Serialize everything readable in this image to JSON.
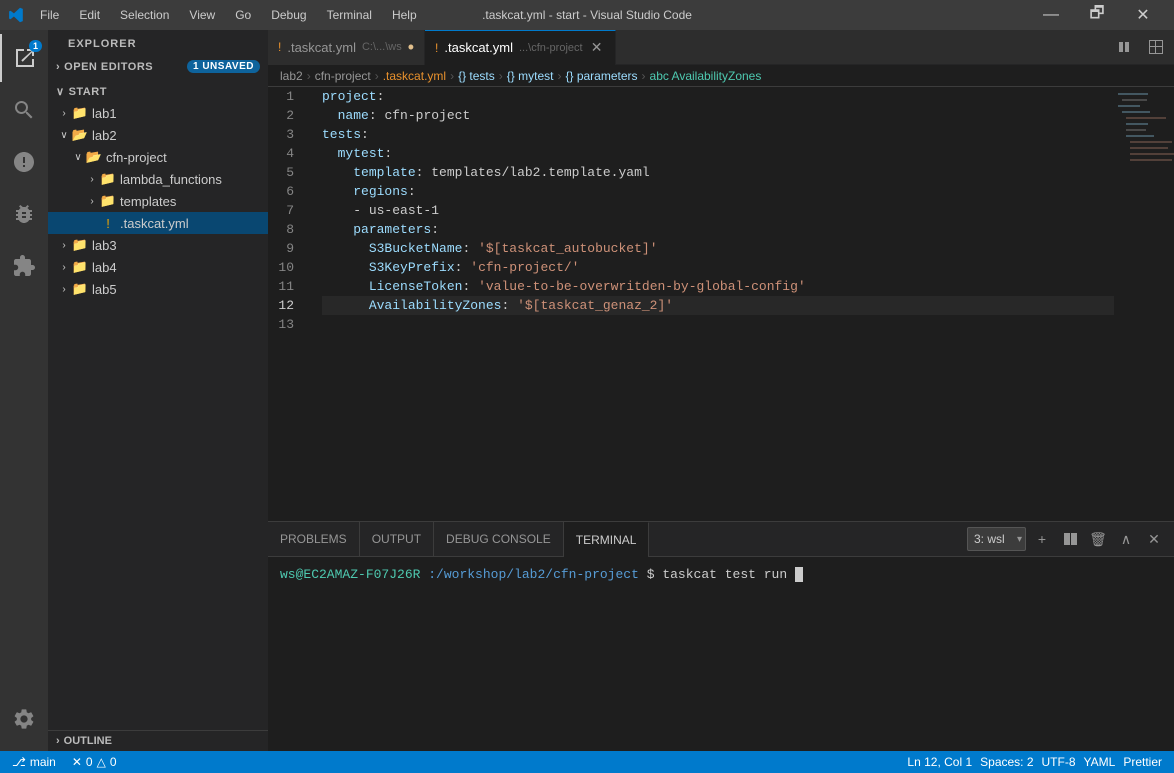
{
  "titlebar": {
    "title": ".taskcat.yml - start - Visual Studio Code",
    "menu_items": [
      "File",
      "Edit",
      "Selection",
      "View",
      "Go",
      "Debug",
      "Terminal",
      "Help"
    ],
    "min_label": "—",
    "max_label": "🗗",
    "close_label": "✕"
  },
  "tabs": [
    {
      "id": "tab1",
      "icon": "!",
      "name": ".taskcat.yml",
      "path": "C:\\...\\ws",
      "modified": true,
      "active": false,
      "closeable": false
    },
    {
      "id": "tab2",
      "icon": "!",
      "name": ".taskcat.yml",
      "path": "...\\cfn-project",
      "modified": false,
      "active": true,
      "closeable": true
    }
  ],
  "breadcrumb": {
    "items": [
      "lab2",
      "cfn-project",
      ".taskcat.yml",
      "{} tests",
      "{} mytest",
      "{} parameters",
      "abc AvailabilityZones"
    ]
  },
  "code_lines": [
    {
      "num": 1,
      "tokens": [
        {
          "t": "key",
          "v": "project"
        },
        {
          "t": "colon",
          "v": ":"
        }
      ]
    },
    {
      "num": 2,
      "tokens": [
        {
          "t": "indent",
          "v": "  "
        },
        {
          "t": "key",
          "v": "name"
        },
        {
          "t": "colon",
          "v": ":"
        },
        {
          "t": "plain",
          "v": " cfn-project"
        }
      ]
    },
    {
      "num": 3,
      "tokens": [
        {
          "t": "key",
          "v": "tests"
        },
        {
          "t": "colon",
          "v": ":"
        }
      ]
    },
    {
      "num": 4,
      "tokens": [
        {
          "t": "indent",
          "v": "  "
        },
        {
          "t": "key",
          "v": "mytest"
        },
        {
          "t": "colon",
          "v": ":"
        }
      ]
    },
    {
      "num": 5,
      "tokens": [
        {
          "t": "indent",
          "v": "    "
        },
        {
          "t": "key",
          "v": "template"
        },
        {
          "t": "colon",
          "v": ":"
        },
        {
          "t": "plain",
          "v": " templates/lab2.template.yaml"
        }
      ]
    },
    {
      "num": 6,
      "tokens": [
        {
          "t": "indent",
          "v": "    "
        },
        {
          "t": "key",
          "v": "regions"
        },
        {
          "t": "colon",
          "v": ":"
        }
      ]
    },
    {
      "num": 7,
      "tokens": [
        {
          "t": "indent",
          "v": "    "
        },
        {
          "t": "dash",
          "v": "- "
        },
        {
          "t": "plain",
          "v": "us-east-1"
        }
      ]
    },
    {
      "num": 8,
      "tokens": [
        {
          "t": "indent",
          "v": "    "
        },
        {
          "t": "key",
          "v": "parameters"
        },
        {
          "t": "colon",
          "v": ":"
        }
      ]
    },
    {
      "num": 9,
      "tokens": [
        {
          "t": "indent",
          "v": "      "
        },
        {
          "t": "key",
          "v": "S3BucketName"
        },
        {
          "t": "colon",
          "v": ":"
        },
        {
          "t": "plain",
          "v": " "
        },
        {
          "t": "str",
          "v": "'$[taskcat_autobucket]'"
        }
      ]
    },
    {
      "num": 10,
      "tokens": [
        {
          "t": "indent",
          "v": "      "
        },
        {
          "t": "key",
          "v": "S3KeyPrefix"
        },
        {
          "t": "colon",
          "v": ":"
        },
        {
          "t": "plain",
          "v": " "
        },
        {
          "t": "str",
          "v": "'cfn-project/'"
        }
      ]
    },
    {
      "num": 11,
      "tokens": [
        {
          "t": "indent",
          "v": "      "
        },
        {
          "t": "key",
          "v": "LicenseToken"
        },
        {
          "t": "colon",
          "v": ":"
        },
        {
          "t": "plain",
          "v": " "
        },
        {
          "t": "str",
          "v": "'value-to-be-overwritden-by-global-config'"
        }
      ]
    },
    {
      "num": 12,
      "tokens": [
        {
          "t": "indent",
          "v": "      "
        },
        {
          "t": "key",
          "v": "AvailabilityZones"
        },
        {
          "t": "colon",
          "v": ":"
        },
        {
          "t": "plain",
          "v": " "
        },
        {
          "t": "str",
          "v": "'$[taskcat_genaz_2]'"
        }
      ]
    },
    {
      "num": 13,
      "tokens": []
    }
  ],
  "sidebar": {
    "explorer_label": "EXPLORER",
    "open_editors_label": "OPEN EDITORS",
    "open_editors_badge": "1 UNSAVED",
    "start_label": "START",
    "items": [
      {
        "id": "lab1",
        "label": "lab1",
        "type": "folder",
        "expanded": false,
        "indent": 0
      },
      {
        "id": "lab2",
        "label": "lab2",
        "type": "folder",
        "expanded": true,
        "indent": 0
      },
      {
        "id": "cfn-project",
        "label": "cfn-project",
        "type": "folder",
        "expanded": true,
        "indent": 1
      },
      {
        "id": "lambda_functions",
        "label": "lambda_functions",
        "type": "folder",
        "expanded": false,
        "indent": 2
      },
      {
        "id": "templates",
        "label": "templates",
        "type": "folder",
        "expanded": false,
        "indent": 2
      },
      {
        "id": ".taskcat.yml",
        "label": ".taskcat.yml",
        "type": "file",
        "expanded": false,
        "indent": 2
      },
      {
        "id": "lab3",
        "label": "lab3",
        "type": "folder",
        "expanded": false,
        "indent": 0
      },
      {
        "id": "lab4",
        "label": "lab4",
        "type": "folder",
        "expanded": false,
        "indent": 0
      },
      {
        "id": "lab5",
        "label": "lab5",
        "type": "folder",
        "expanded": false,
        "indent": 0
      }
    ],
    "outline_label": "OUTLINE"
  },
  "terminal": {
    "tabs": [
      "PROBLEMS",
      "OUTPUT",
      "DEBUG CONSOLE",
      "TERMINAL"
    ],
    "active_tab": "TERMINAL",
    "shell_options": [
      "3: wsl"
    ],
    "prompt_user": "ws@EC2AMAZ-F07J26R",
    "prompt_path": ":/workshop/lab2/cfn-project",
    "prompt_dollar": "$",
    "command": "taskcat test run"
  },
  "statusbar": {
    "branch_icon": "⎇",
    "branch_name": "main",
    "errors_icon": "✕",
    "errors": "0",
    "warnings_icon": "△",
    "warnings": "0",
    "right_items": [
      "Ln 12, Col 1",
      "Spaces: 2",
      "UTF-8",
      "YAML",
      "Prettier"
    ]
  },
  "colors": {
    "accent": "#007acc",
    "sidebar_bg": "#252526",
    "editor_bg": "#1e1e1e",
    "active_line": "#282828",
    "tab_active_bg": "#1e1e1e",
    "tab_inactive_bg": "#2d2d2d"
  }
}
